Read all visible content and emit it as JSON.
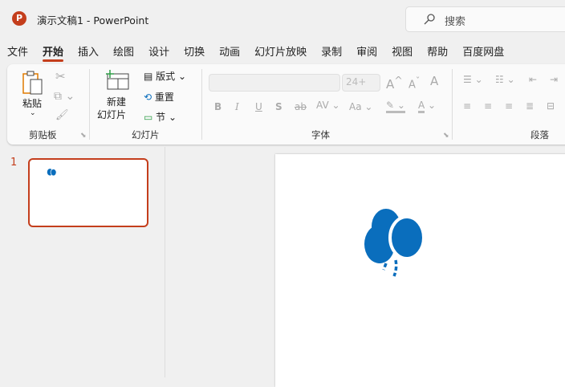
{
  "app": {
    "title": "演示文稿1  -  PowerPoint",
    "logo": "P",
    "accent": "#c43e1c"
  },
  "search": {
    "placeholder": "搜索"
  },
  "tabs": [
    {
      "label": "文件"
    },
    {
      "label": "开始",
      "active": true
    },
    {
      "label": "插入"
    },
    {
      "label": "绘图"
    },
    {
      "label": "设计"
    },
    {
      "label": "切换"
    },
    {
      "label": "动画"
    },
    {
      "label": "幻灯片放映"
    },
    {
      "label": "录制"
    },
    {
      "label": "审阅"
    },
    {
      "label": "视图"
    },
    {
      "label": "帮助"
    },
    {
      "label": "百度网盘"
    }
  ],
  "ribbon": {
    "clipboard": {
      "label": "剪贴板",
      "paste": "粘贴"
    },
    "slides": {
      "label": "幻灯片",
      "new_slide_1": "新建",
      "new_slide_2": "幻灯片",
      "layout": "版式",
      "reset": "重置",
      "section": "节"
    },
    "font": {
      "label": "字体",
      "font_name": "",
      "font_size": "24+",
      "bold": "B",
      "italic": "I",
      "underline": "U",
      "shadow": "S",
      "strike": "ab",
      "spacing": "AV",
      "case": "Aa",
      "color": "A"
    },
    "paragraph": {
      "label": "段落"
    }
  },
  "slides_panel": {
    "slide_number": "1"
  },
  "balloon_color": "#0a6ebd"
}
